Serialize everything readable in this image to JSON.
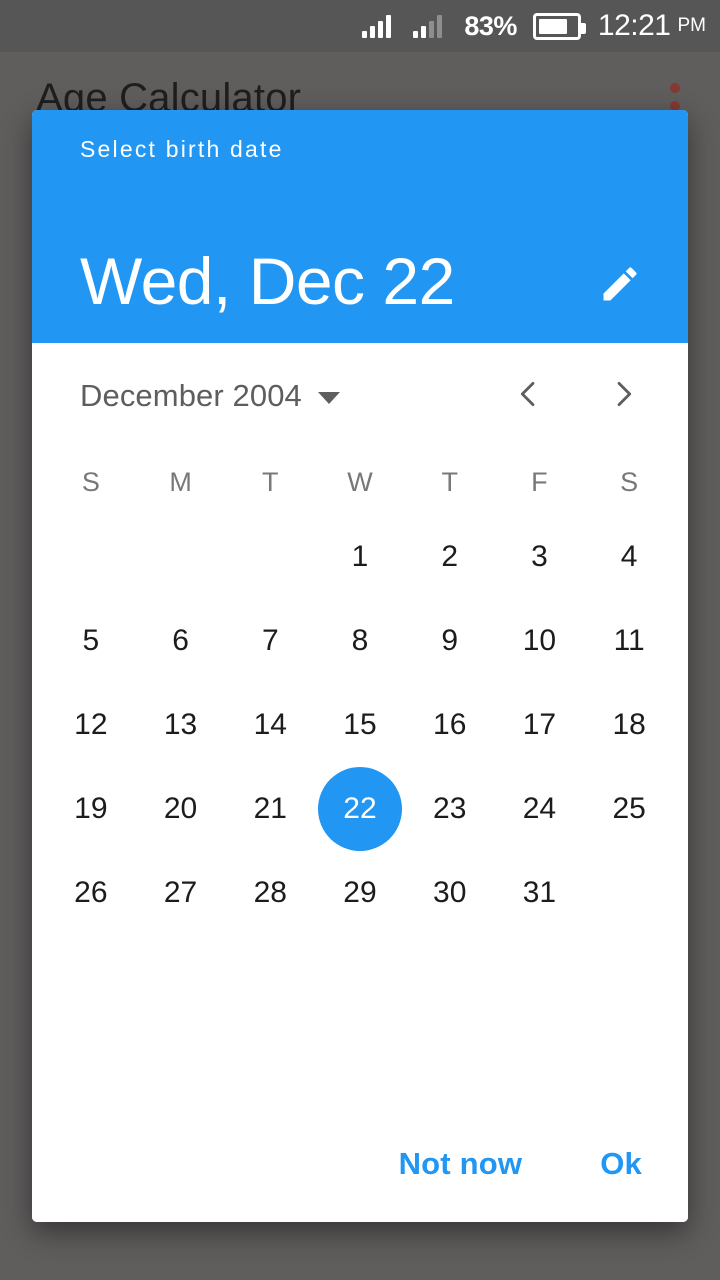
{
  "status_bar": {
    "battery_percent": "83%",
    "time": "12:21",
    "ampm": "PM",
    "signal_1_bars": 4,
    "signal_2_bars": 2,
    "background_color": "#565656"
  },
  "app": {
    "title": "Age Calculator",
    "overflow_menu_color": "#b5392c"
  },
  "dialog": {
    "subtitle": "Select birth date",
    "selected_date_label": "Wed, Dec 22",
    "accent_color": "#2196f3",
    "edit_icon": "pencil-icon",
    "actions": {
      "cancel_label": "Not now",
      "confirm_label": "Ok"
    }
  },
  "calendar": {
    "month_year_label": "December 2004",
    "dropdown_icon": "chevron-down-icon",
    "prev_icon": "chevron-left-icon",
    "next_icon": "chevron-right-icon",
    "weekday_headers": [
      "S",
      "M",
      "T",
      "W",
      "T",
      "F",
      "S"
    ],
    "leading_blanks": 3,
    "days": [
      1,
      2,
      3,
      4,
      5,
      6,
      7,
      8,
      9,
      10,
      11,
      12,
      13,
      14,
      15,
      16,
      17,
      18,
      19,
      20,
      21,
      22,
      23,
      24,
      25,
      26,
      27,
      28,
      29,
      30,
      31
    ],
    "selected_day": 22,
    "selected_day_bg": "#2196f3",
    "selected_day_color": "#ffffff"
  }
}
